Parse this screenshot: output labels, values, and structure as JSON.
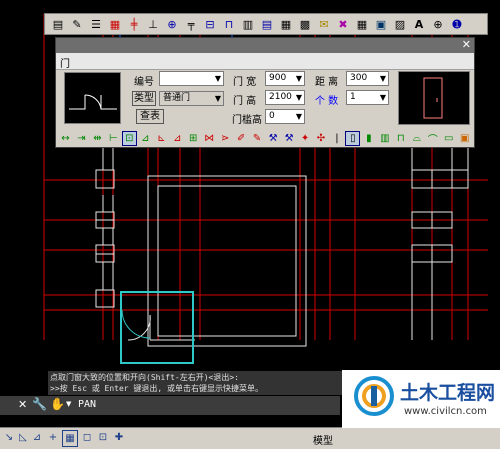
{
  "colors": {
    "grid_red": "#d40000",
    "axis_blue": "#1a6cff",
    "wall_white": "#e8e8e8",
    "door_cyan": "#2ec8c8"
  },
  "dialog": {
    "title": "门",
    "close_icon": "close-icon",
    "labels": {
      "number": "编号",
      "type_button": "类型",
      "type_value": "普通门",
      "query_button": "查表",
      "width_label": "门 宽",
      "height_label": "门 高",
      "sill_label": "门槛高",
      "distance_label": "距 离",
      "count_label": "个 数"
    },
    "values": {
      "number": "",
      "width": "900",
      "height": "2100",
      "sill": "0",
      "distance": "300",
      "count": "1"
    }
  },
  "command": {
    "line1": "点取门窗大致的位置和开向(Shift-左右开)<退出>:",
    "line2": ">>按 Esc 或 Enter 键退出, 或单击右键显示快捷菜单。",
    "current": "PAN"
  },
  "status": {
    "model_tab": "模型"
  },
  "logo": {
    "text": "土木工程网",
    "url": "www.civilcn.com"
  }
}
